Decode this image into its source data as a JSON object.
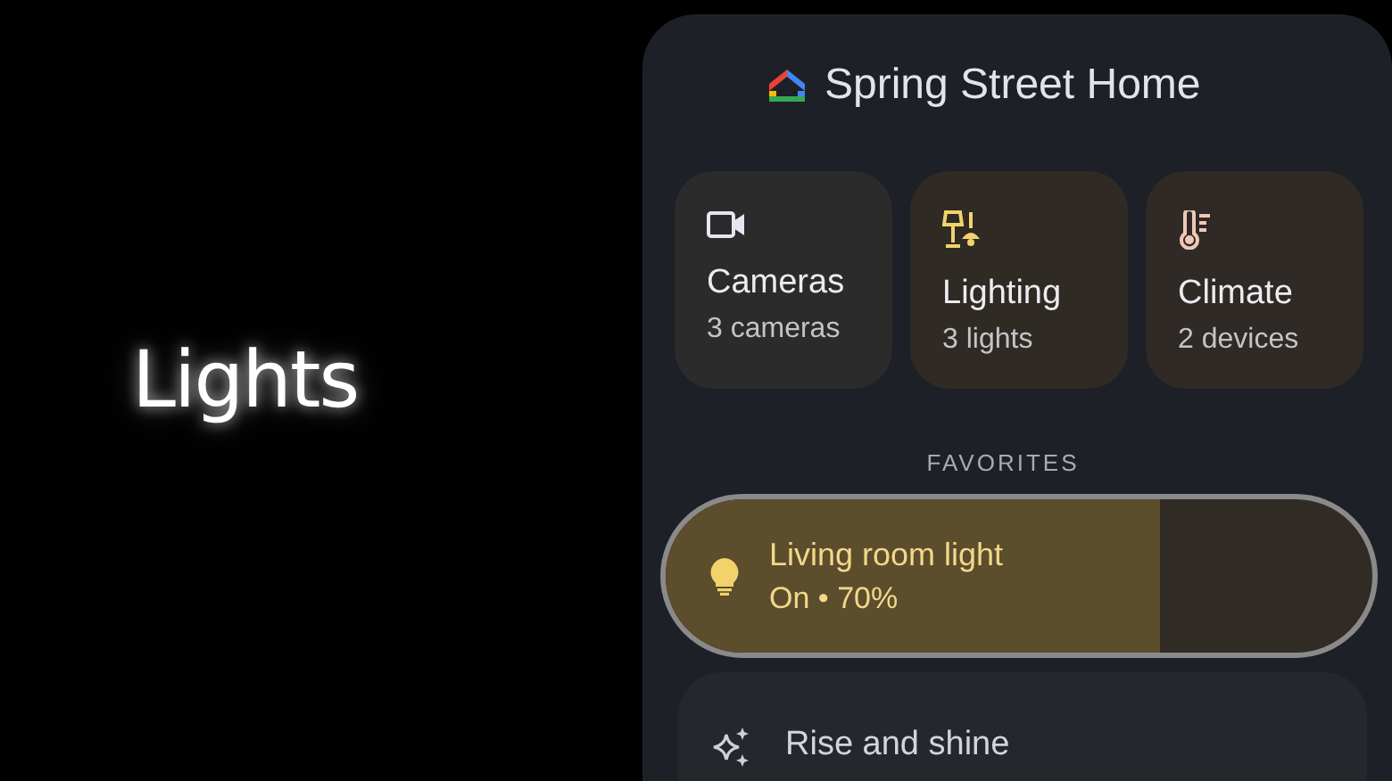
{
  "promo": {
    "heading": "Lights"
  },
  "home": {
    "title": "Spring Street Home"
  },
  "categories": [
    {
      "kind": "camera",
      "name": "Cameras",
      "count": "3 cameras"
    },
    {
      "kind": "lighting",
      "name": "Lighting",
      "count": "3 lights"
    },
    {
      "kind": "climate",
      "name": "Climate",
      "count": "2 devices"
    }
  ],
  "favorites": {
    "heading": "FAVORITES",
    "items": [
      {
        "kind": "light",
        "name": "Living room light",
        "status": "On • 70%",
        "on": true,
        "level": 0.7
      },
      {
        "kind": "routine",
        "name": "Rise and shine"
      }
    ]
  }
}
